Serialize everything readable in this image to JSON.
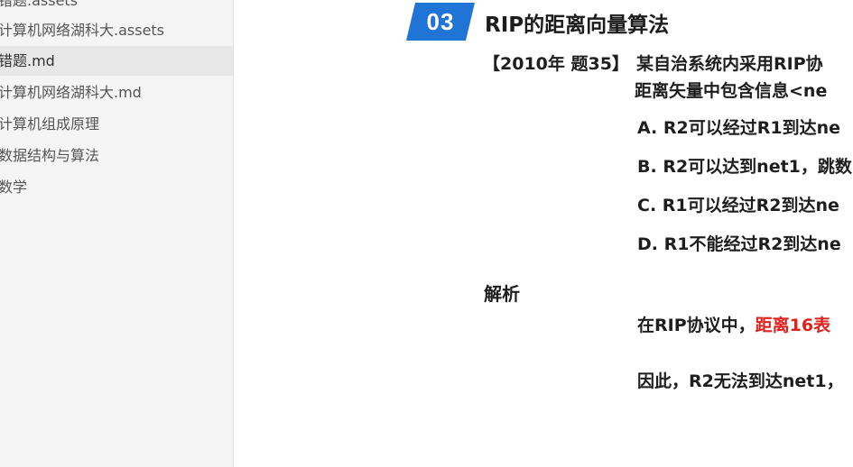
{
  "sidebar": {
    "items": [
      {
        "label": "错题.assets"
      },
      {
        "label": "计算机网络湖科大.assets"
      },
      {
        "label": "错题.md"
      },
      {
        "label": "计算机网络湖科大.md"
      },
      {
        "label": "计算机组成原理"
      },
      {
        "label": "数据结构与算法"
      },
      {
        "label": "数学"
      }
    ],
    "active_index": 2
  },
  "slide": {
    "section_number": "03",
    "section_title": "RIP的距离向量算法",
    "question": {
      "source": "【2010年 题35】",
      "line1": "某自治系统内采用RIP协",
      "line2": "距离矢量中包含信息<ne"
    },
    "options": [
      "A. R2可以经过R1到达ne",
      "B. R2可以达到net1，跳数",
      "C. R1可以经过R2到达ne",
      "D. R1不能经过R2到达ne"
    ],
    "analysis": {
      "heading": "解析",
      "line1_prefix": "在RIP协议中，",
      "line1_highlight": "距离16表",
      "line2": "因此，R2无法到达net1，"
    },
    "colors": {
      "badge": "#1f74d6",
      "highlight": "#e0211c"
    }
  }
}
